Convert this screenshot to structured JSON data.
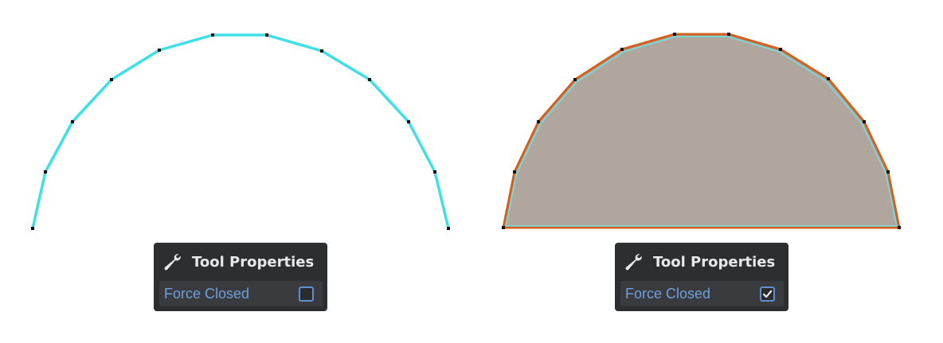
{
  "panels": [
    {
      "title": "Tool Properties",
      "icon": "wrench-icon",
      "option_label": "Force Closed",
      "force_closed": false
    },
    {
      "title": "Tool Properties",
      "icon": "wrench-icon",
      "option_label": "Force Closed",
      "force_closed": true
    }
  ],
  "colors": {
    "open_path_stroke": "#3ee0e6",
    "closed_fill": "#b1a69e",
    "closed_outer_stroke": "#d2611e",
    "closed_inner_stroke": "#6fe0e4",
    "vertex": "#111111",
    "panel_bg": "#2d2e30",
    "label_blue": "#6f9fdc"
  }
}
